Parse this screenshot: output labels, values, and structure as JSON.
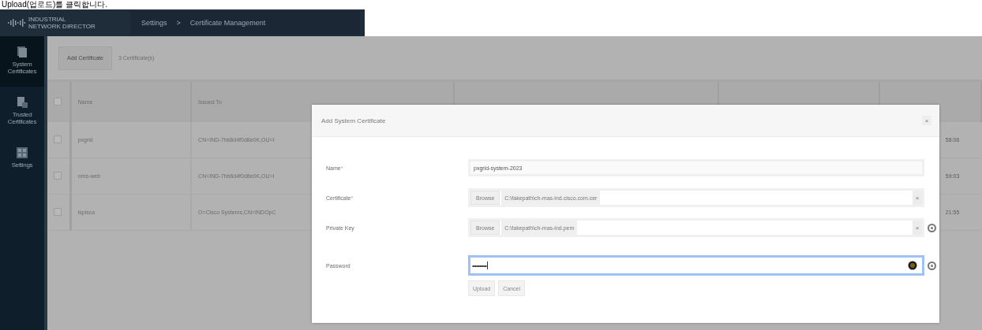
{
  "caption": "Upload(업로드)를 클릭합니다.",
  "header": {
    "product": [
      "INDUSTRIAL",
      "NETWORK DIRECTOR"
    ],
    "breadcrumb": [
      "Settings",
      "Certificate Management"
    ],
    "separator": ">"
  },
  "sidebar": {
    "items": [
      {
        "label": "System Certificates",
        "selected": true
      },
      {
        "label": "Trusted Certificates",
        "selected": false
      },
      {
        "label": "Settings",
        "selected": false
      }
    ]
  },
  "toolbar": {
    "button": "Add Certificate",
    "count": "3 Certificate(s)"
  },
  "table": {
    "header_checked": false,
    "columns": [
      "Name",
      "Issued To"
    ],
    "rows": [
      {
        "checked": false,
        "cells": [
          "pxgrid",
          "CN=IND-7hb8d4f0d8e0K,OU=I",
          "58:06"
        ]
      },
      {
        "checked": false,
        "cells": [
          "nms-web",
          "CN=IND-7hb8d4f0d8e0K,OU=I",
          "59:03"
        ]
      },
      {
        "checked": false,
        "cells": [
          "ispisca",
          "O=Cisco Systems,CN=INDOpC",
          "21:55"
        ]
      }
    ]
  },
  "dialog": {
    "title": "Add System Certificate",
    "close": "×",
    "fields": [
      {
        "kind": "text",
        "label": "Name",
        "required_mark": "*",
        "value": "pxgrid-system-2023"
      },
      {
        "kind": "file",
        "label": "Certificate",
        "required_mark": "*",
        "button": "Browse",
        "value": "C:\\fakepath\\ch-mas-ind.cisco.com.cer",
        "clear": "×",
        "info": false
      },
      {
        "kind": "file",
        "label": "Private Key",
        "button": "Browse",
        "value": "C:\\fakepath\\ch-mas-ind.pem",
        "clear": "×",
        "info": true
      },
      {
        "kind": "password",
        "label": "Password",
        "value": "••••••••••",
        "focused": true,
        "info": true
      }
    ],
    "buttons": [
      "Upload",
      "Cancel"
    ]
  }
}
